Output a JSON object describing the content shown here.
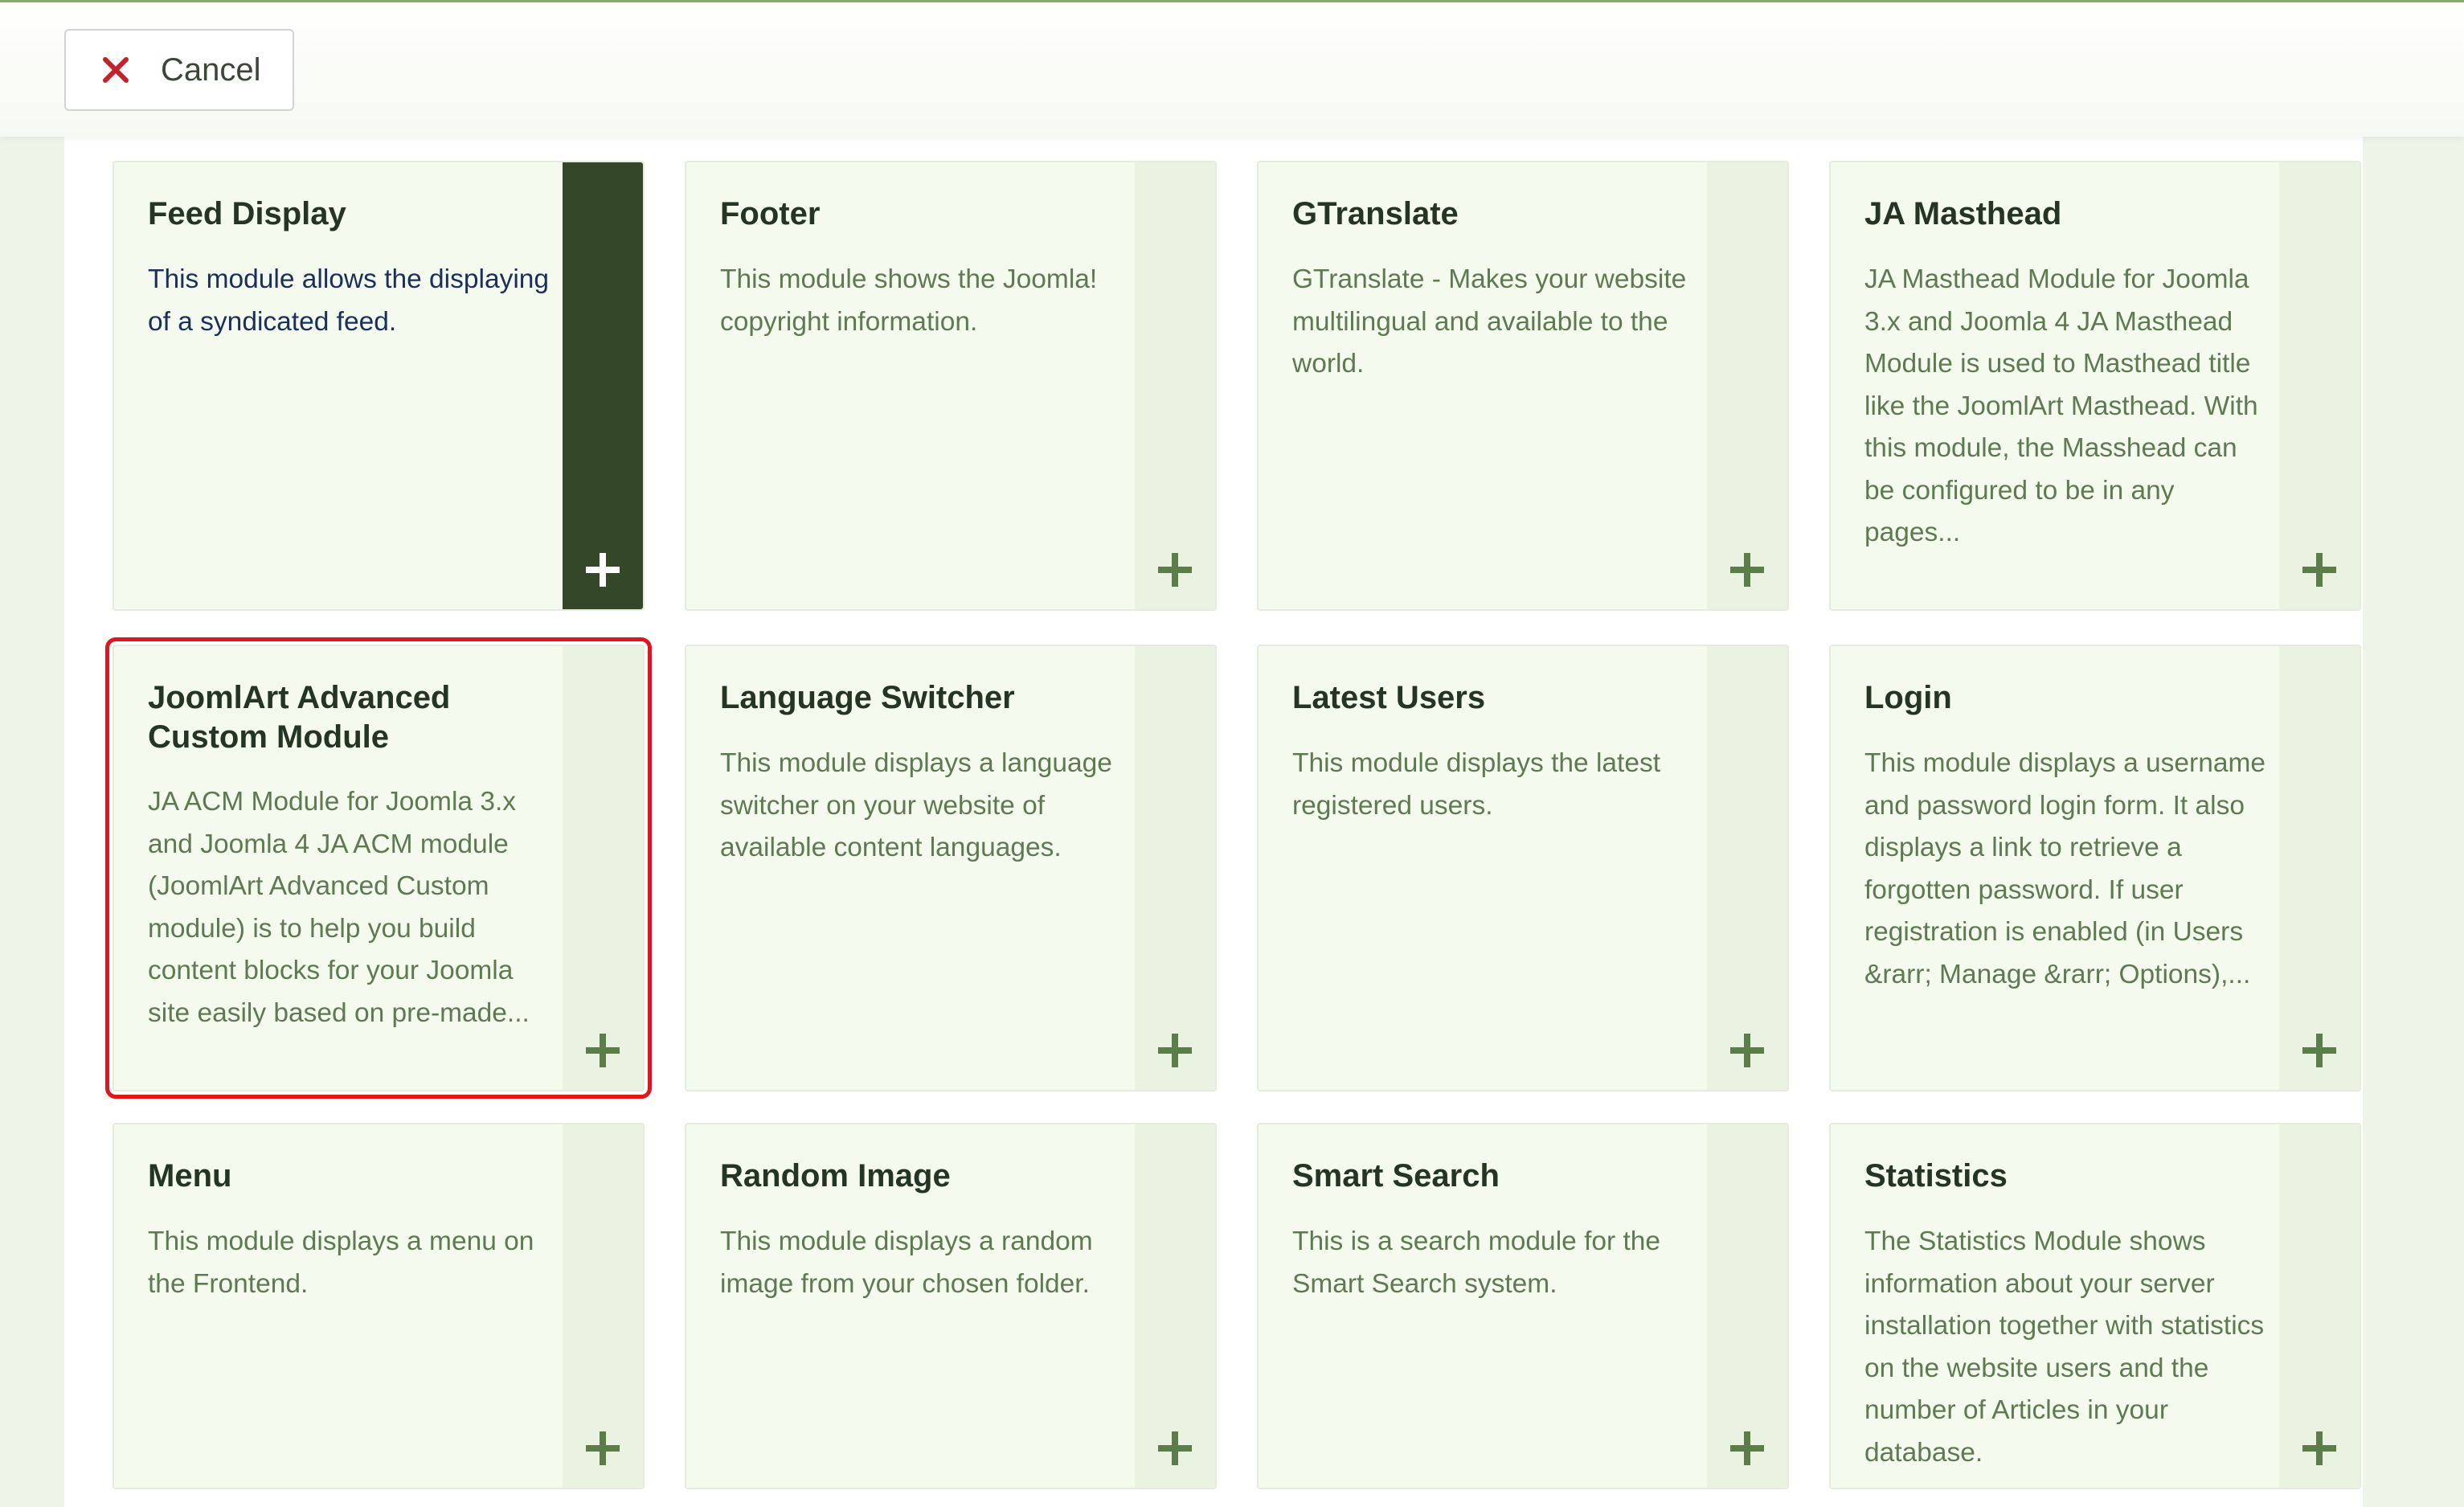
{
  "toolbar": {
    "cancel_label": "Cancel"
  },
  "colors": {
    "accent_dark": "#344729",
    "text_green": "#5e7a50",
    "selected_outline": "#e0161f",
    "cancel_x": "#c4222a"
  },
  "modules": [
    {
      "title": "Feed Display",
      "description": "This module allows the displaying of a syndicated feed."
    },
    {
      "title": "Footer",
      "description": "This module shows the Joomla! copyright information."
    },
    {
      "title": "GTranslate",
      "description": "GTranslate - Makes your website multilingual and available to the world."
    },
    {
      "title": "JA Masthead",
      "description": "JA Masthead Module for Joomla 3.x and Joomla 4 JA Masthead Module is used to Masthead title like the JoomlArt Masthead. With this module, the Masshead can be configured to be in any pages..."
    },
    {
      "title": "JoomlArt Advanced Custom Module",
      "description": "JA ACM Module for Joomla 3.x and Joomla 4 JA ACM module (JoomlArt Advanced Custom module) is to help you build content blocks for your Joomla site easily based on pre-made..."
    },
    {
      "title": "Language Switcher",
      "description": "This module displays a language switcher on your website of available content languages."
    },
    {
      "title": "Latest Users",
      "description": "This module displays the latest registered users."
    },
    {
      "title": "Login",
      "description": "This module displays a username and password login form. It also displays a link to retrieve a forgotten password. If user registration is enabled (in Users &rarr; Manage &rarr; Options),..."
    },
    {
      "title": "Menu",
      "description": "This module displays a menu on the Frontend."
    },
    {
      "title": "Random Image",
      "description": "This module displays a random image from your chosen folder."
    },
    {
      "title": "Smart Search",
      "description": "This is a search module for the Smart Search system."
    },
    {
      "title": "Statistics",
      "description": "The Statistics Module shows information about your server installation together with statistics on the website users and the number of Articles in your database."
    }
  ]
}
